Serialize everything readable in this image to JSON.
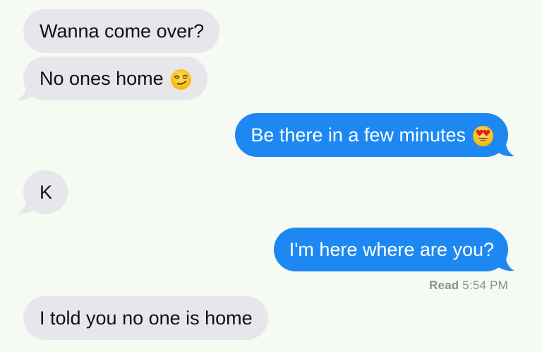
{
  "conversation": {
    "messages": [
      {
        "direction": "incoming",
        "text": "Wanna come over?"
      },
      {
        "direction": "incoming",
        "text": "No ones home",
        "emoji": "smirking-face-emoji"
      },
      {
        "direction": "outgoing",
        "text": "Be there in a few minutes",
        "emoji": "heart-eyes-face-emoji"
      },
      {
        "direction": "incoming",
        "text": "K"
      },
      {
        "direction": "outgoing",
        "text": "I'm here where are you?"
      },
      {
        "direction": "incoming",
        "text": "I told you no one is home"
      }
    ],
    "read_receipt": {
      "label": "Read",
      "time": "5:54 PM"
    }
  },
  "colors": {
    "background": "#f5faf2",
    "incoming_bubble": "#e6e6eb",
    "outgoing_bubble": "#1d88f2",
    "incoming_text": "#111111",
    "outgoing_text": "#ffffff",
    "receipt_text": "#8e8e93"
  }
}
